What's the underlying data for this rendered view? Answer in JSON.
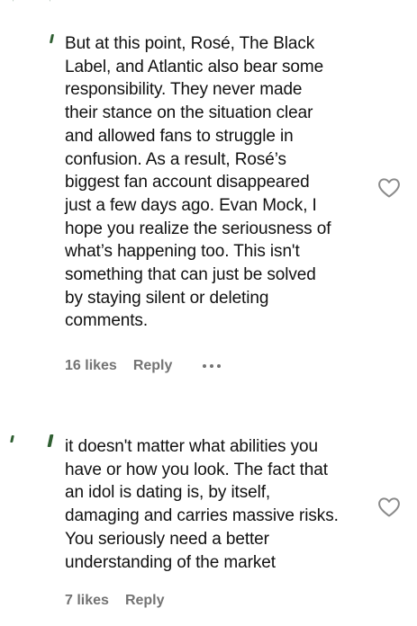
{
  "comments": [
    {
      "text": "But at this point, Rosé, The Black\nLabel, and Atlantic also bear some\nresponsibility. They never made\ntheir stance on the situation clear\nand allowed fans to struggle in\nconfusion. As a result, Rosé’s\nbiggest fan account disappeared\njust a few days ago. Evan Mock, I\nhope you realize the seriousness of\nwhat’s happening too. This isn't\nsomething that can just be solved\nby staying silent or deleting\ncomments.",
      "likes": "16 likes",
      "reply_label": "Reply",
      "like_icon": "heart-outline-icon",
      "more_icon": "more-options-icon"
    },
    {
      "text": "it doesn't matter what abilities you\nhave or how you look. The fact that\nan idol is dating is, by itself,\ndamaging and carries massive risks.\nYou seriously need a better\nunderstanding of the market",
      "likes": "7 likes",
      "reply_label": "Reply",
      "like_icon": "heart-outline-icon"
    }
  ],
  "colors": {
    "text": "#111111",
    "meta": "#737373",
    "icon": "#8a8a8a",
    "accent_green": "#2f5f32"
  }
}
